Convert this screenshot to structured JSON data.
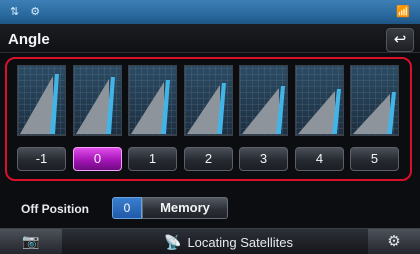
{
  "status": {
    "left_icons": "⇅ ⚙",
    "right_icons": "📶"
  },
  "header": {
    "title": "Angle",
    "back_icon": "↩"
  },
  "angles": [
    {
      "label": "-1",
      "selected": false
    },
    {
      "label": "0",
      "selected": true
    },
    {
      "label": "1",
      "selected": false
    },
    {
      "label": "2",
      "selected": false
    },
    {
      "label": "3",
      "selected": false
    },
    {
      "label": "4",
      "selected": false
    },
    {
      "label": "5",
      "selected": false
    }
  ],
  "off_position": {
    "label": "Off Position",
    "value": "0",
    "memory_label": "Memory"
  },
  "footer": {
    "left_icon": "📷",
    "gps_icon": "📡",
    "gps_text": "Locating Satellites",
    "right_icon": "⚙"
  },
  "colors": {
    "accent_selected": "#b21bc6",
    "frame": "#d8102a",
    "status_bar": "#2f72aa"
  }
}
